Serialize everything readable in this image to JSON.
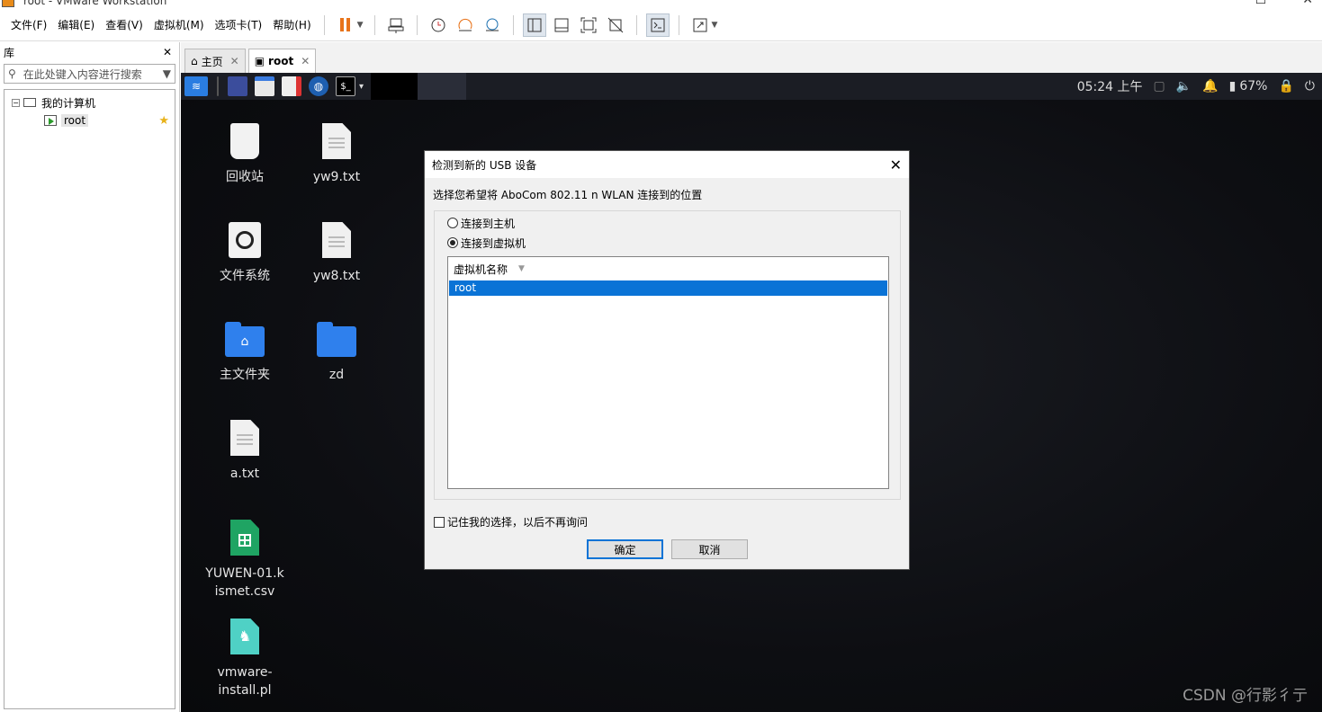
{
  "window": {
    "title": "root - VMware Workstation"
  },
  "menu": [
    "文件(F)",
    "编辑(E)",
    "查看(V)",
    "虚拟机(M)",
    "选项卡(T)",
    "帮助(H)"
  ],
  "toolbar_icons": [
    "pause-icon",
    "send-ctrl-alt-del-icon",
    "snapshot-icon",
    "revert-snapshot-icon",
    "snapshot-manager-icon",
    "show-library-icon",
    "thumbnail-bar-icon",
    "full-screen-icon",
    "unity-icon",
    "console-view-icon",
    "stretch-icon"
  ],
  "library": {
    "title": "库",
    "close": "✕",
    "search_placeholder": "在此处键入内容进行搜索",
    "tree": {
      "root_label": "我的计算机",
      "vm_label": "root"
    }
  },
  "tabs": [
    {
      "label": "主页",
      "close": "✕"
    },
    {
      "label": "root",
      "close": "✕"
    }
  ],
  "guest": {
    "panel": {
      "clock": "05:24 上午",
      "battery": "67%"
    },
    "desktop_icons": [
      {
        "label": "回收站",
        "icon": "trash-icon"
      },
      {
        "label": "yw9.txt",
        "icon": "text-file-icon"
      },
      {
        "label": "文件系统",
        "icon": "filesystem-icon"
      },
      {
        "label": "yw8.txt",
        "icon": "text-file-icon"
      },
      {
        "label": "主文件夹",
        "icon": "home-folder-icon"
      },
      {
        "label": "zd",
        "icon": "folder-icon"
      },
      {
        "label": "a.txt",
        "icon": "text-file-icon"
      },
      {
        "label": "YUWEN-01.kismet.csv",
        "icon": "spreadsheet-icon"
      },
      {
        "label": "vmware-install.pl",
        "icon": "perl-script-icon"
      }
    ],
    "watermark": "CSDN @行影彳亍"
  },
  "dialog": {
    "title": "检测到新的 USB 设备",
    "close": "✕",
    "prompt": "选择您希望将 AboCom 802.11 n WLAN 连接到的位置",
    "options": [
      {
        "label": "连接到主机",
        "selected": false
      },
      {
        "label": "连接到虚拟机",
        "selected": true
      }
    ],
    "list_header": "虚拟机名称",
    "list_rows": [
      "root"
    ],
    "remember_label": "记住我的选择，以后不再询问",
    "remember_checked": false,
    "ok": "确定",
    "cancel": "取消"
  },
  "colors": {
    "accent": "#0a73d6",
    "pause": "#e8731a",
    "folder": "#2f80ed"
  }
}
